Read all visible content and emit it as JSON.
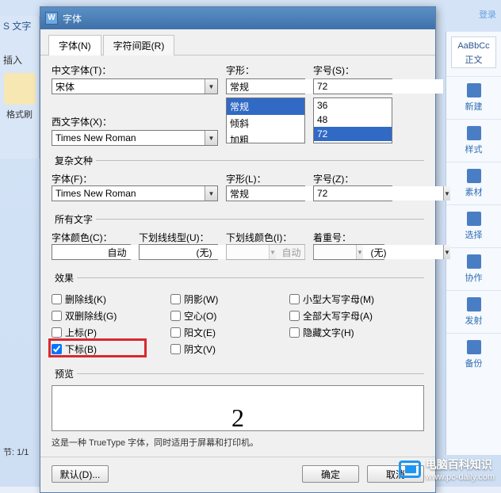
{
  "window": {
    "title": "字体"
  },
  "tabs": {
    "font": "字体(N)",
    "spacing": "字符间距(R)"
  },
  "chinese_font": {
    "label": "中文字体(T)：",
    "value": "宋体"
  },
  "style": {
    "label": "字形：",
    "value": "常规",
    "options": [
      "常规",
      "倾斜",
      "加粗"
    ]
  },
  "size": {
    "label": "字号(S)：",
    "value": "72",
    "options": [
      "36",
      "48",
      "72"
    ]
  },
  "western_font": {
    "label": "西文字体(X)：",
    "value": "Times New Roman"
  },
  "complex": {
    "legend": "复杂文种",
    "font_label": "字体(F)：",
    "font_value": "Times New Roman",
    "style_label": "字形(L)：",
    "style_value": "常规",
    "size_label": "字号(Z)：",
    "size_value": "72"
  },
  "all_text": {
    "legend": "所有文字",
    "color_label": "字体颜色(C)：",
    "color_value": "自动",
    "underline_label": "下划线线型(U)：",
    "underline_value": "(无)",
    "ul_color_label": "下划线颜色(I)：",
    "ul_color_value": "自动",
    "emphasis_label": "着重号：",
    "emphasis_value": "(无)"
  },
  "effects": {
    "legend": "效果",
    "strike": "删除线(K)",
    "double_strike": "双删除线(G)",
    "superscript": "上标(P)",
    "subscript": "下标(B)",
    "shadow": "阴影(W)",
    "hollow": "空心(O)",
    "emboss": "阳文(E)",
    "engrave": "阴文(V)",
    "small_caps": "小型大写字母(M)",
    "all_caps": "全部大写字母(A)",
    "hidden": "隐藏文字(H)"
  },
  "preview": {
    "legend": "预览",
    "sample": "2",
    "desc": "这是一种 TrueType 字体，同时适用于屏幕和打印机。"
  },
  "buttons": {
    "default": "默认(D)...",
    "ok": "确定",
    "cancel": "取消"
  },
  "bg": {
    "app_title": "S 文字",
    "insert": "插入",
    "format": "格式刷",
    "style_sample_a": "AaBbCc",
    "style_sample_b": "正文",
    "side": {
      "new": "新建",
      "style": "样式",
      "material": "素材",
      "select": "选择",
      "collab": "协作",
      "launch": "发射",
      "backup": "备份"
    },
    "status": "节: 1/1",
    "login": "登录"
  },
  "watermark": {
    "title": "电脑百科知识",
    "url": "www.pc-daily.com"
  }
}
